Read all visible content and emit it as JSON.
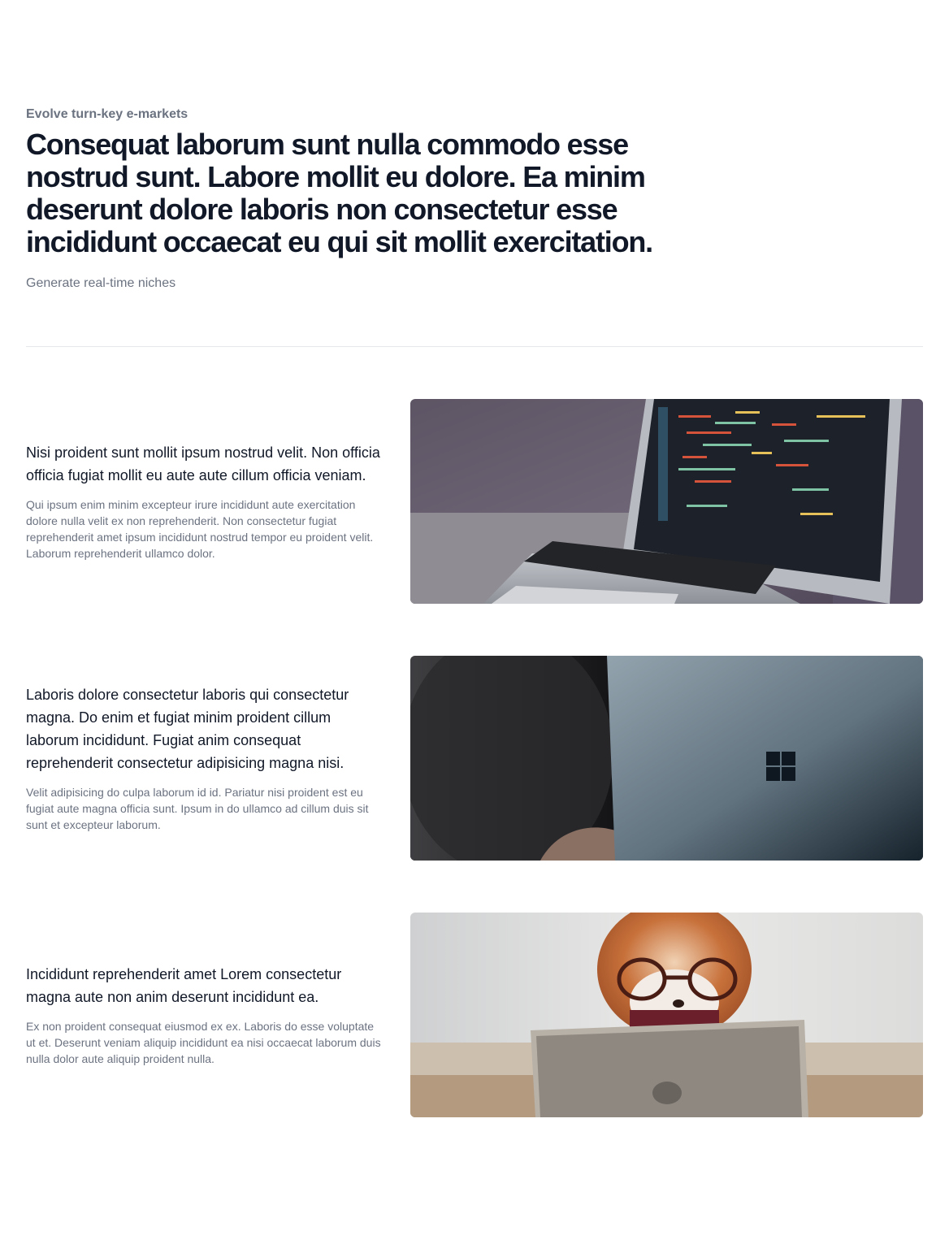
{
  "header": {
    "eyebrow": "Evolve turn-key e-markets",
    "title": "Consequat laborum sunt nulla commodo esse nostrud sunt. Labore mollit eu dolore. Ea minim deserunt dolore laboris non consectetur esse incididunt occaecat eu qui sit mollit exercitation.",
    "subtitle": "Generate real-time niches"
  },
  "features": [
    {
      "title": "Nisi proident sunt mollit ipsum nostrud velit. Non officia officia fugiat mollit eu aute aute cillum officia veniam.",
      "description": "Qui ipsum enim minim excepteur irure incididunt aute exercitation dolore nulla velit ex non reprehenderit. Non consectetur fugiat reprehenderit amet ipsum incididunt nostrud tempor eu proident velit. Laborum reprehenderit ullamco dolor.",
      "image": "laptop-code-photo"
    },
    {
      "title": "Laboris dolore consectetur laboris qui consectetur magna. Do enim et fugiat minim proident cillum laborum incididunt. Fugiat anim consequat reprehenderit consectetur adipisicing magna nisi.",
      "description": "Velit adipisicing do culpa laborum id id. Pariatur nisi proident est eu fugiat aute magna officia sunt. Ipsum in do ullamco ad cillum duis sit sunt et excepteur laborum.",
      "image": "surface-laptop-photo"
    },
    {
      "title": "Incididunt reprehenderit amet Lorem consectetur magna aute non anim deserunt incididunt ea.",
      "description": "Ex non proident consequat eiusmod ex ex. Laboris do esse voluptate ut et. Deserunt veniam aliquip incididunt ea nisi occaecat laborum duis nulla dolor aute aliquip proident nulla.",
      "image": "dog-with-tablet-photo"
    }
  ]
}
